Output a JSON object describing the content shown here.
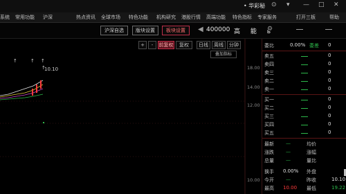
{
  "window": {
    "title": "• 华彩秘",
    "controls": [
      "⊙",
      "▾",
      "—",
      "□",
      "✕"
    ]
  },
  "menu": {
    "items": [
      "系统",
      "常用功能",
      "沪深",
      "热点资讯",
      "全球市场",
      "特色功能",
      "机构研究",
      "港股行情",
      "高端功能",
      "特色指标",
      "专家服务",
      "打开三板",
      "帮助"
    ]
  },
  "toolbar": {
    "tabs": [
      "沪深自选",
      "版块设置",
      "板块设置"
    ],
    "active_tab_index": 2,
    "stock_code": "400000",
    "stock_name": "高 能 ь",
    "gear_icon": "gear-icon"
  },
  "chart": {
    "controls": [
      "+",
      "-",
      "前复权",
      "复权",
      "日线",
      "周线",
      "分钟"
    ],
    "active_control_index": 2,
    "overlay_label": "叠加指标",
    "price_annotation": "10.10",
    "y_axis": [
      "18.00",
      "14.00",
      "12.00",
      "10.00"
    ],
    "colors": {
      "up": "#ff3b3b",
      "down": "#2db84a",
      "ma1": "#e6e6e6",
      "ma2": "#e8c93a",
      "ma3": "#d046d0"
    }
  },
  "info_panel": {
    "header": {
      "label": "委比",
      "value": "0.00%",
      "label2": "委差",
      "vol": "0"
    },
    "asks": [
      {
        "label": "卖五",
        "vol": "0"
      },
      {
        "label": "卖四",
        "vol": "0"
      },
      {
        "label": "卖三",
        "vol": "0"
      },
      {
        "label": "卖二",
        "vol": "0"
      },
      {
        "label": "卖一",
        "vol": "0"
      }
    ],
    "bids": [
      {
        "label": "买一",
        "vol": "0"
      },
      {
        "label": "买二",
        "vol": "0"
      },
      {
        "label": "买三",
        "vol": "0"
      },
      {
        "label": "买四",
        "vol": "0"
      },
      {
        "label": "买五",
        "vol": "0"
      }
    ],
    "stats": [
      {
        "l1": "最新",
        "v1": "—",
        "l2": "均价",
        "v2": ""
      },
      {
        "l1": "涨跌",
        "v1": "—",
        "l2": "涨幅",
        "v2": ""
      },
      {
        "l1": "总量",
        "v1": "—",
        "l2": "量比",
        "v2": ""
      },
      {
        "l1": "换手",
        "v1": "0.00%",
        "l2": "外盘",
        "v2": ""
      },
      {
        "l1": "今开",
        "v1": "—",
        "l2": "昨收",
        "v2": "10.10"
      },
      {
        "l1": "最高",
        "v1": "10.00",
        "l2": "最低",
        "v2": "19.22"
      }
    ]
  }
}
